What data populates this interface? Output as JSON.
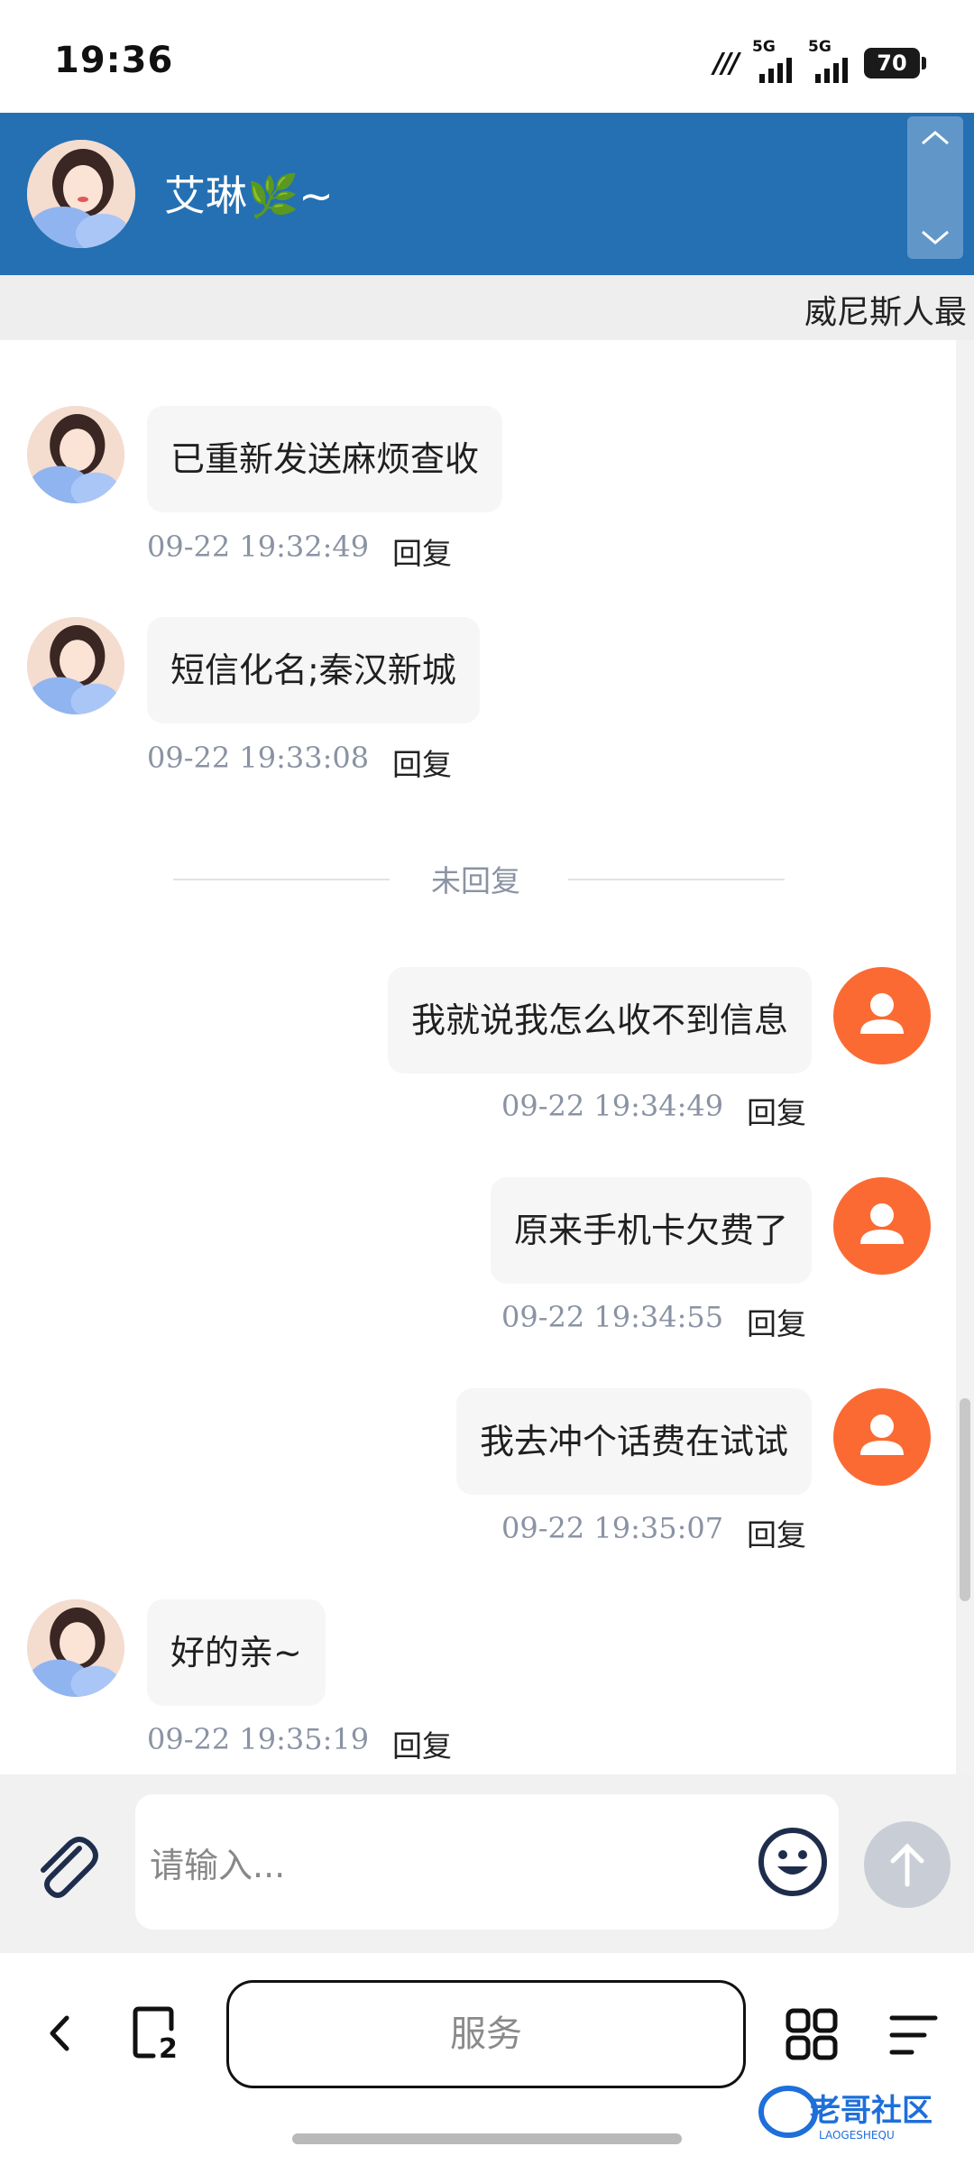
{
  "status_bar": {
    "time": "19:36",
    "network": "??",
    "signal1": "5G",
    "signal2": "5G",
    "battery": "70"
  },
  "header": {
    "contact_name": "艾琳🌿~"
  },
  "marquee": {
    "text": "威尼斯人最"
  },
  "messages": [
    {
      "side": "left",
      "text": "已重新发送麻烦查收",
      "time": "09-22 19:32:49",
      "reply": "回复"
    },
    {
      "side": "left",
      "text": "短信化名;秦汉新城",
      "time": "09-22 19:33:08",
      "reply": "回复"
    },
    {
      "side": "right",
      "text": "我就说我怎么收不到信息",
      "time": "09-22 19:34:49",
      "reply": "回复"
    },
    {
      "side": "right",
      "text": "原来手机卡欠费了",
      "time": "09-22 19:34:55",
      "reply": "回复"
    },
    {
      "side": "right",
      "text": "我去冲个话费在试试",
      "time": "09-22 19:35:07",
      "reply": "回复"
    },
    {
      "side": "left",
      "text": "好的亲~",
      "time": "09-22 19:35:19",
      "reply": "回复"
    }
  ],
  "divider": {
    "text": "未回复"
  },
  "input": {
    "placeholder": "请输入..."
  },
  "bottom_nav": {
    "service_label": "服务",
    "tab_count": "2"
  },
  "watermark": {
    "text": "老哥社区",
    "subtext": "LAOGESHEQU"
  },
  "colors": {
    "header": "#2470b3",
    "user_avatar": "#fb6a33",
    "time_text": "#8a93a3"
  }
}
